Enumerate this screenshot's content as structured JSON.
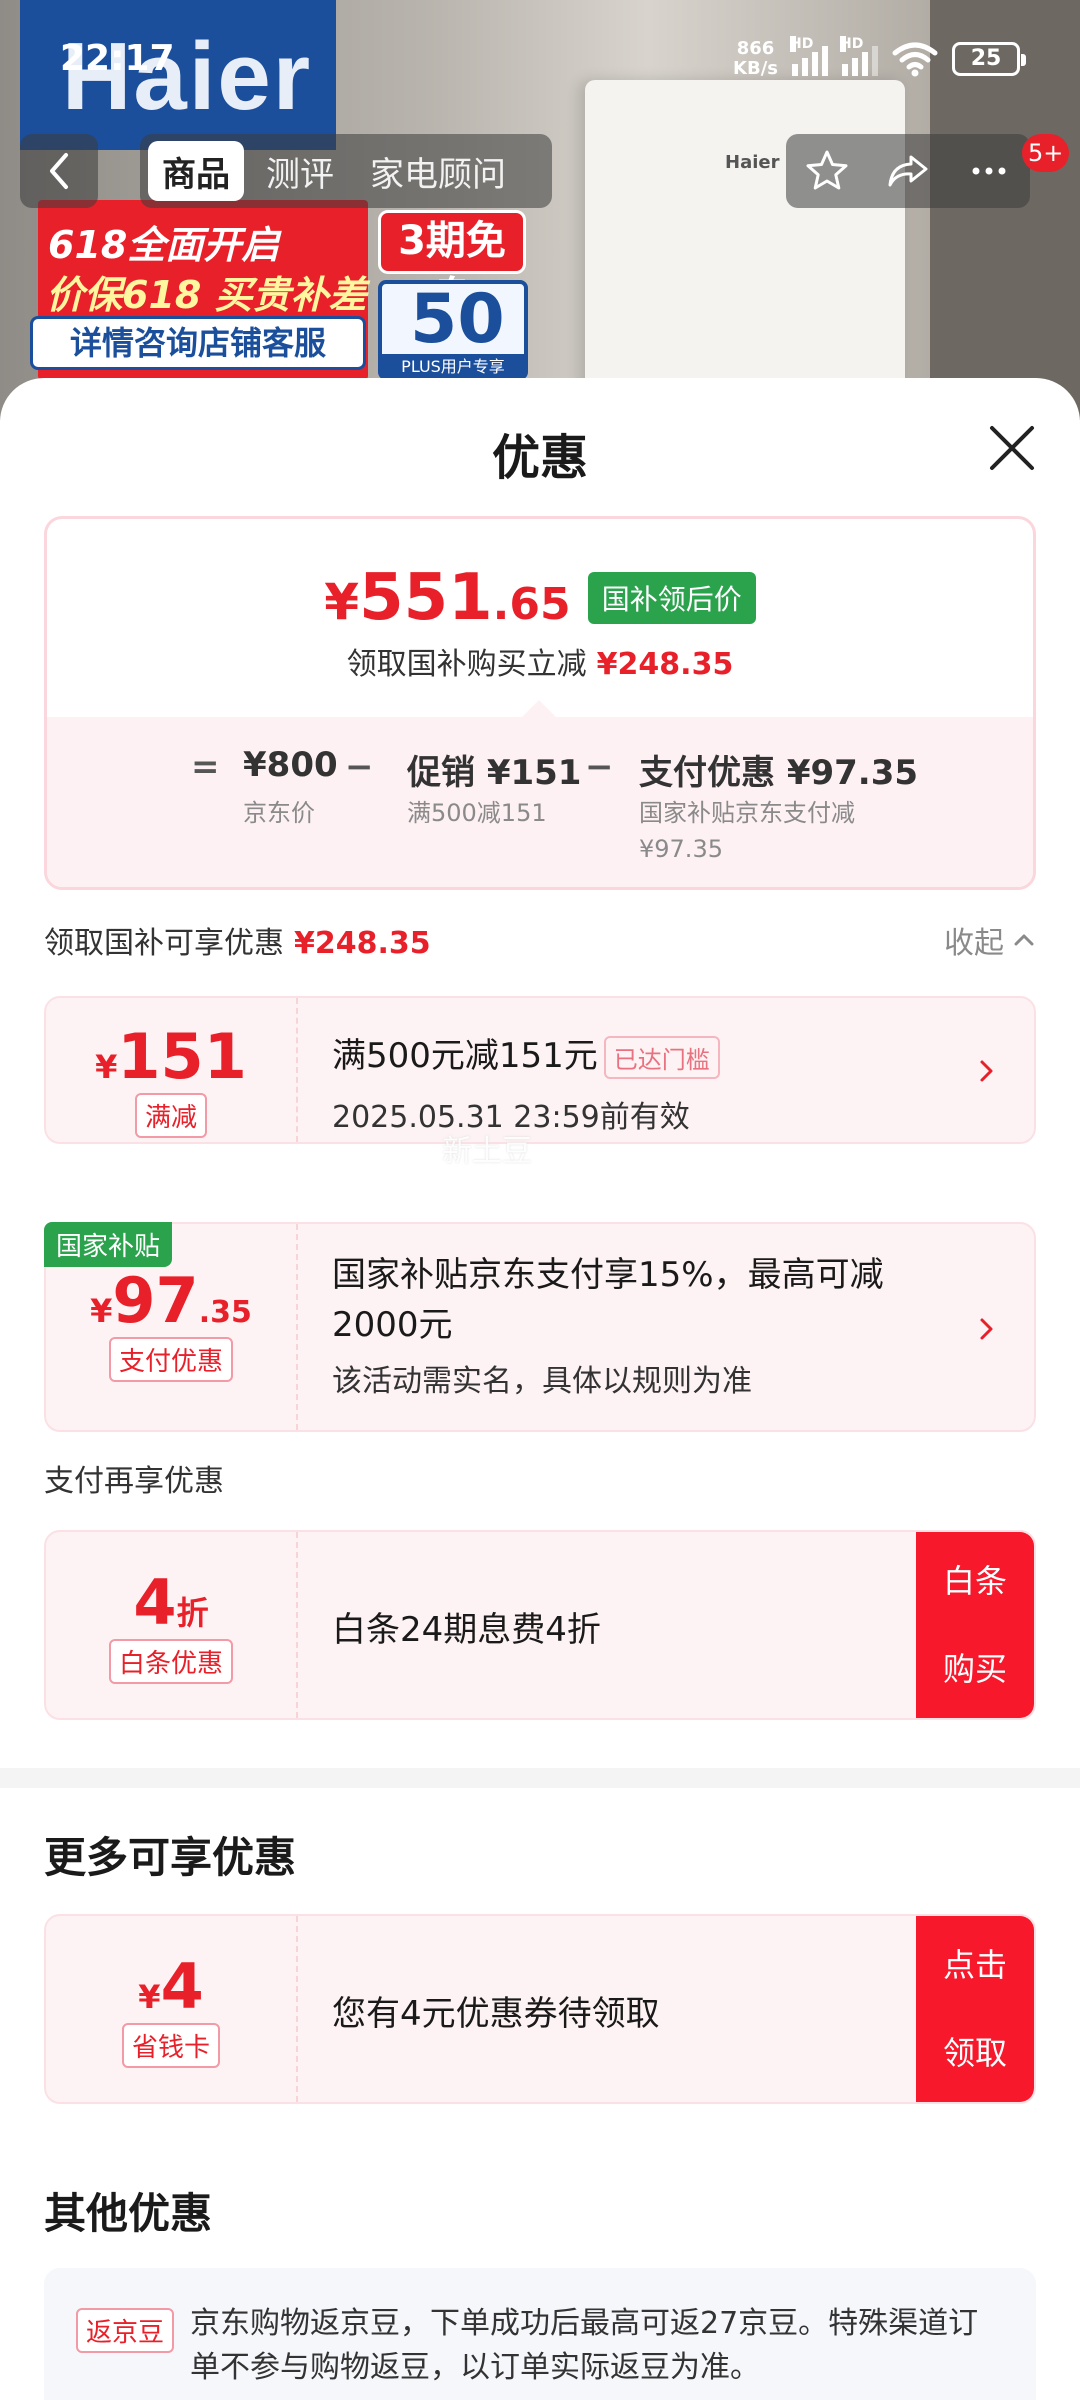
{
  "status_bar": {
    "time": "22:17",
    "net_speed_value": "866",
    "net_speed_unit": "KB/s",
    "signal_label": "HD",
    "battery": "25"
  },
  "background": {
    "brand_logo": "Haier",
    "heater_brand": "Haier",
    "promo_line1": "618全面开启",
    "promo_line2": "价保618 买贵补差",
    "promo_line3": "详情咨询店铺客服",
    "promo_badge": "3期免息",
    "plus_value": "50",
    "plus_tag": "PLUS用户专享"
  },
  "nav": {
    "back_icon": "chevron-left-icon",
    "tabs": [
      {
        "label": "商品",
        "active": true
      },
      {
        "label": "测评",
        "active": false
      },
      {
        "label": "家电顾问",
        "active": false
      }
    ],
    "actions": [
      "star-icon",
      "share-icon",
      "more-icon"
    ],
    "message_badge": "5+"
  },
  "sheet": {
    "title": "优惠",
    "close_icon": "close-icon"
  },
  "price_card": {
    "yen": "¥",
    "price_int": "551",
    "price_dec": ".65",
    "badge": "国补领后价",
    "save_text": "领取国补购买立减",
    "save_amount": "¥248.35",
    "eq": "=",
    "jd_price": "¥800",
    "jd_price_label": "京东价",
    "minus1": "−",
    "promo": "促销 ¥151",
    "promo_label": "满500减151",
    "minus2": "−",
    "pay": "支付优惠 ¥97.35",
    "pay_label_1": "国家补贴京东支付减",
    "pay_label_2": "¥97.35"
  },
  "summary": {
    "label": "领取国补可享优惠",
    "amount": "¥248.35",
    "collapse": "收起",
    "collapse_icon": "chevron-up-icon"
  },
  "coupons": [
    {
      "yen": "¥",
      "amount": "151",
      "tag": "满减",
      "title": "满500元减151元",
      "status": "已达门槛",
      "sub": "2025.05.31 23:59前有效",
      "watermark": "新土豆"
    },
    {
      "corner": "国家补贴",
      "yen": "¥",
      "amount": "97",
      "decimal": ".35",
      "tag": "支付优惠",
      "title_1": "国家补贴京东支付享15%，最高可减",
      "title_2": "2000元",
      "sub": "该活动需实名，具体以规则为准"
    }
  ],
  "pay_section": {
    "label": "支付再享优惠",
    "amount": "4",
    "unit": "折",
    "tag": "白条优惠",
    "title": "白条24期息费4折",
    "cta_line1": "白条",
    "cta_line2": "购买"
  },
  "more_section": {
    "heading": "更多可享优惠",
    "yen": "¥",
    "amount": "4",
    "tag": "省钱卡",
    "title": "您有4元优惠券待领取",
    "cta_line1": "点击",
    "cta_line2": "领取"
  },
  "other_section": {
    "heading": "其他优惠",
    "tag": "返京豆",
    "text": "京东购物返京豆，下单成功后最高可返27京豆。特殊渠道订单不参与购物返豆，以订单实际返豆为准。"
  },
  "colors": {
    "accent_red": "#e8202a",
    "green": "#2ba34d",
    "pink_bg": "#fdf3f4"
  }
}
